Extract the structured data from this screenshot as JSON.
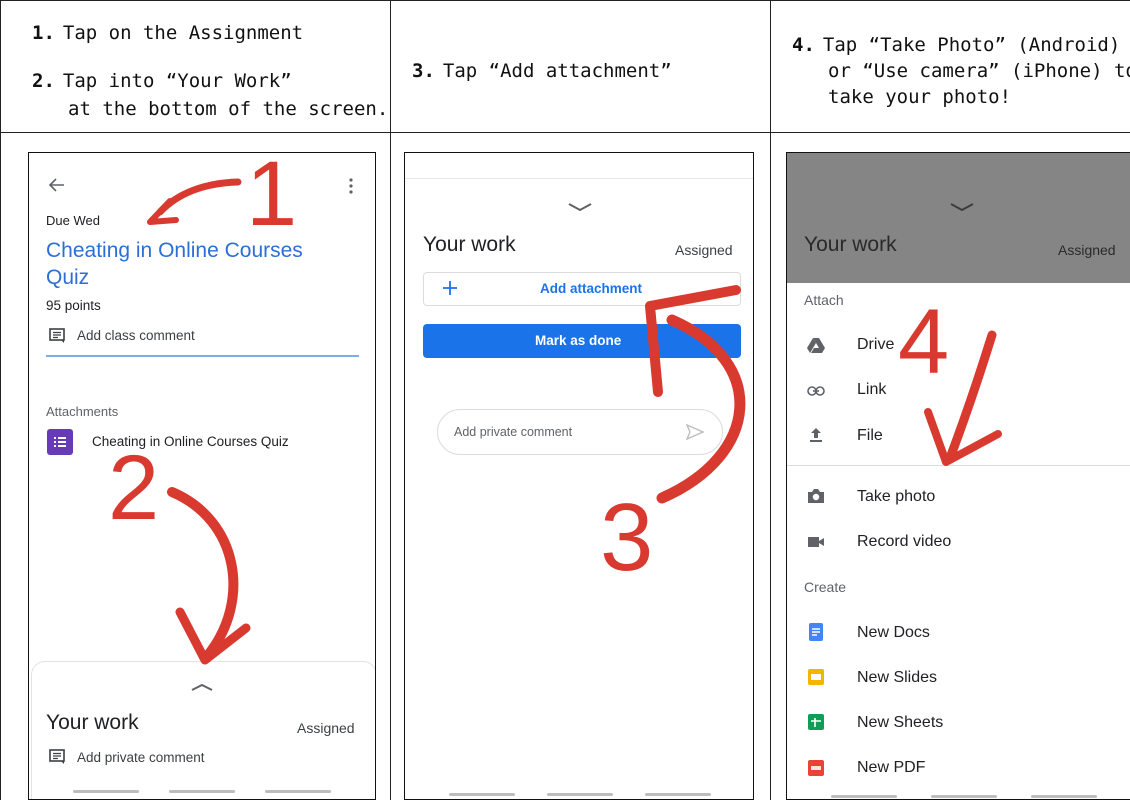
{
  "instructions": {
    "step1_num": "1.",
    "step1_text": "Tap on the Assignment",
    "step2_num": "2.",
    "step2_line1": "Tap into “Your Work”",
    "step2_line2": "at the bottom of the screen.",
    "step3_num": "3.",
    "step3_text": "Tap “Add attachment”",
    "step4_num": "4.",
    "step4_line1": "Tap “Take Photo” (Android)",
    "step4_line2": "or “Use camera” (iPhone) to",
    "step4_line3": "take your photo!"
  },
  "screen1": {
    "due": "Due Wed",
    "title_line1": "Cheating in Online Courses",
    "title_line2": "Quiz",
    "points": "95 points",
    "class_comment": "Add class comment",
    "attachments_label": "Attachments",
    "attachment_name": "Cheating in Online Courses Quiz",
    "your_work": "Your work",
    "status": "Assigned",
    "private_comment": "Add private comment"
  },
  "screen2": {
    "your_work": "Your work",
    "status": "Assigned",
    "add_attachment": "Add attachment",
    "mark_done": "Mark as done",
    "private_comment_placeholder": "Add private comment"
  },
  "screen3": {
    "your_work": "Your work",
    "status": "Assigned",
    "attach_label": "Attach",
    "drive": "Drive",
    "link": "Link",
    "file": "File",
    "take_photo": "Take photo",
    "record_video": "Record video",
    "create_label": "Create",
    "new_docs": "New Docs",
    "new_slides": "New Slides",
    "new_sheets": "New Sheets",
    "new_pdf": "New PDF"
  },
  "annotations": {
    "n1": "1",
    "n2": "2",
    "n3": "3",
    "n4": "4"
  },
  "colors": {
    "classroom_blue": "#1a73e8",
    "title_blue": "#2b6fd6",
    "annotation_red": "#d93a30",
    "forms_purple": "#673ab7",
    "docs_blue": "#4285f4",
    "slides_yellow": "#f4b400",
    "sheets_green": "#0f9d58",
    "pdf_red": "#ea4335"
  },
  "icons": {
    "back": "arrow-left-icon",
    "more": "more-vert-icon",
    "comment": "comment-icon",
    "forms": "forms-icon",
    "add": "plus-icon",
    "send": "send-icon",
    "drive": "drive-icon",
    "link": "link-icon",
    "file": "upload-icon",
    "camera": "camera-icon",
    "video": "videocam-icon",
    "docs": "docs-icon",
    "slides": "slides-icon",
    "sheets": "sheets-icon",
    "pdf": "pdf-icon"
  }
}
